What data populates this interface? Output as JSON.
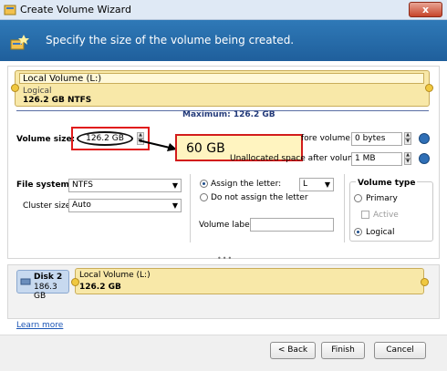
{
  "window": {
    "title": "Create Volume Wizard",
    "close_glyph": "x"
  },
  "header": {
    "text": "Specify the size of the volume being created."
  },
  "volume_preview": {
    "name": "Local Volume (L:)",
    "type": "Logical",
    "size_fs": "126.2 GB NTFS",
    "maximum": "Maximum: 126.2 GB"
  },
  "size": {
    "label": "Volume size:",
    "value": "126.2 GB",
    "callout": "60 GB"
  },
  "unallocated": {
    "before_label": "fore volume:",
    "before_value": "0 bytes",
    "after_label": "Unallocated space after volume:",
    "after_value": "1 MB"
  },
  "filesystem": {
    "fs_label": "File system:",
    "fs_value": "NTFS",
    "cluster_label": "Cluster size:",
    "cluster_value": "Auto"
  },
  "letter": {
    "assign_label": "Assign the letter:",
    "letter_value": "L",
    "no_assign_label": "Do not assign the letter",
    "volume_label_label": "Volume label:",
    "volume_label_value": ""
  },
  "volume_type": {
    "title": "Volume type",
    "primary": "Primary",
    "active": "Active",
    "logical": "Logical",
    "selected": "Logical"
  },
  "grip": "•••",
  "disk": {
    "name": "Disk 2",
    "size": "186.3 GB",
    "volume_name": "Local Volume (L:)",
    "volume_size": "126.2 GB"
  },
  "learn_more": "Learn more",
  "buttons": {
    "back": "< Back",
    "finish": "Finish",
    "cancel": "Cancel"
  },
  "colors": {
    "header": "#2a6eab",
    "volume": "#f8e8a8",
    "callout_border": "#d21c1c"
  }
}
